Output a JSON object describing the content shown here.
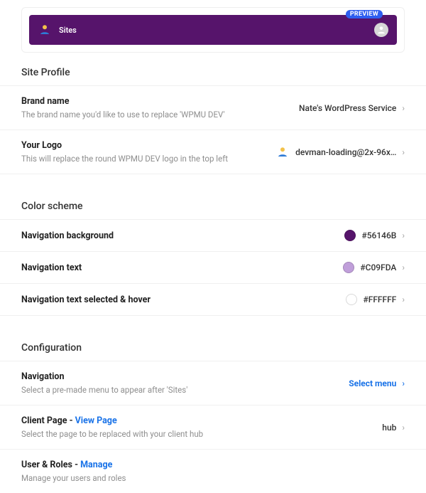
{
  "preview": {
    "badge": "PREVIEW",
    "title": "Sites"
  },
  "siteProfile": {
    "heading": "Site Profile",
    "brand": {
      "title": "Brand name",
      "desc": "The brand name you'd like to use to replace 'WPMU DEV'",
      "value": "Nate's WordPress Service"
    },
    "logo": {
      "title": "Your Logo",
      "desc": "This will replace the round WPMU DEV logo in the top left",
      "value": "devman-loading@2x-96x…"
    }
  },
  "colorScheme": {
    "heading": "Color scheme",
    "navBg": {
      "title": "Navigation background",
      "value": "#56146B",
      "swatch": "#56146B"
    },
    "navText": {
      "title": "Navigation text",
      "value": "#C09FDA",
      "swatch": "#C09FDA"
    },
    "navSel": {
      "title": "Navigation text selected & hover",
      "value": "#FFFFFF",
      "swatch": "#FFFFFF"
    }
  },
  "config": {
    "heading": "Configuration",
    "navigation": {
      "title": "Navigation",
      "desc": "Select a pre-made menu to appear after 'Sites'",
      "value": "Select menu"
    },
    "clientPage": {
      "titlePrefix": "Client Page - ",
      "link": "View Page",
      "desc": "Select the page to be replaced with your client hub",
      "value": "hub"
    },
    "userRoles": {
      "titlePrefix": "User & Roles - ",
      "link": "Manage",
      "desc": "Manage your users and roles"
    }
  }
}
